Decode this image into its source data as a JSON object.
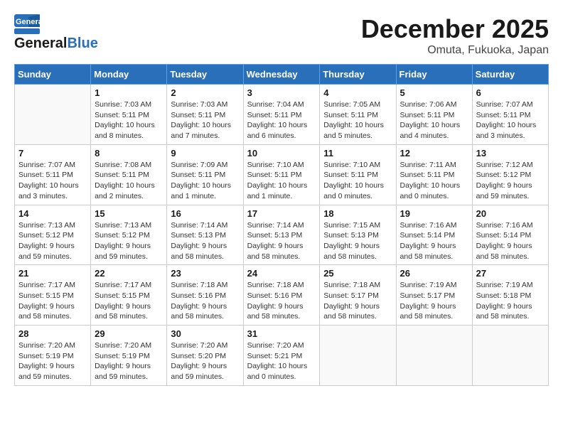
{
  "header": {
    "logo_line1": "General",
    "logo_line2": "Blue",
    "month_title": "December 2025",
    "location": "Omuta, Fukuoka, Japan"
  },
  "weekdays": [
    "Sunday",
    "Monday",
    "Tuesday",
    "Wednesday",
    "Thursday",
    "Friday",
    "Saturday"
  ],
  "weeks": [
    [
      {
        "day": "",
        "info": ""
      },
      {
        "day": "1",
        "info": "Sunrise: 7:03 AM\nSunset: 5:11 PM\nDaylight: 10 hours\nand 8 minutes."
      },
      {
        "day": "2",
        "info": "Sunrise: 7:03 AM\nSunset: 5:11 PM\nDaylight: 10 hours\nand 7 minutes."
      },
      {
        "day": "3",
        "info": "Sunrise: 7:04 AM\nSunset: 5:11 PM\nDaylight: 10 hours\nand 6 minutes."
      },
      {
        "day": "4",
        "info": "Sunrise: 7:05 AM\nSunset: 5:11 PM\nDaylight: 10 hours\nand 5 minutes."
      },
      {
        "day": "5",
        "info": "Sunrise: 7:06 AM\nSunset: 5:11 PM\nDaylight: 10 hours\nand 4 minutes."
      },
      {
        "day": "6",
        "info": "Sunrise: 7:07 AM\nSunset: 5:11 PM\nDaylight: 10 hours\nand 3 minutes."
      }
    ],
    [
      {
        "day": "7",
        "info": "Sunrise: 7:07 AM\nSunset: 5:11 PM\nDaylight: 10 hours\nand 3 minutes."
      },
      {
        "day": "8",
        "info": "Sunrise: 7:08 AM\nSunset: 5:11 PM\nDaylight: 10 hours\nand 2 minutes."
      },
      {
        "day": "9",
        "info": "Sunrise: 7:09 AM\nSunset: 5:11 PM\nDaylight: 10 hours\nand 1 minute."
      },
      {
        "day": "10",
        "info": "Sunrise: 7:10 AM\nSunset: 5:11 PM\nDaylight: 10 hours\nand 1 minute."
      },
      {
        "day": "11",
        "info": "Sunrise: 7:10 AM\nSunset: 5:11 PM\nDaylight: 10 hours\nand 0 minutes."
      },
      {
        "day": "12",
        "info": "Sunrise: 7:11 AM\nSunset: 5:11 PM\nDaylight: 10 hours\nand 0 minutes."
      },
      {
        "day": "13",
        "info": "Sunrise: 7:12 AM\nSunset: 5:12 PM\nDaylight: 9 hours\nand 59 minutes."
      }
    ],
    [
      {
        "day": "14",
        "info": "Sunrise: 7:13 AM\nSunset: 5:12 PM\nDaylight: 9 hours\nand 59 minutes."
      },
      {
        "day": "15",
        "info": "Sunrise: 7:13 AM\nSunset: 5:12 PM\nDaylight: 9 hours\nand 59 minutes."
      },
      {
        "day": "16",
        "info": "Sunrise: 7:14 AM\nSunset: 5:13 PM\nDaylight: 9 hours\nand 58 minutes."
      },
      {
        "day": "17",
        "info": "Sunrise: 7:14 AM\nSunset: 5:13 PM\nDaylight: 9 hours\nand 58 minutes."
      },
      {
        "day": "18",
        "info": "Sunrise: 7:15 AM\nSunset: 5:13 PM\nDaylight: 9 hours\nand 58 minutes."
      },
      {
        "day": "19",
        "info": "Sunrise: 7:16 AM\nSunset: 5:14 PM\nDaylight: 9 hours\nand 58 minutes."
      },
      {
        "day": "20",
        "info": "Sunrise: 7:16 AM\nSunset: 5:14 PM\nDaylight: 9 hours\nand 58 minutes."
      }
    ],
    [
      {
        "day": "21",
        "info": "Sunrise: 7:17 AM\nSunset: 5:15 PM\nDaylight: 9 hours\nand 58 minutes."
      },
      {
        "day": "22",
        "info": "Sunrise: 7:17 AM\nSunset: 5:15 PM\nDaylight: 9 hours\nand 58 minutes."
      },
      {
        "day": "23",
        "info": "Sunrise: 7:18 AM\nSunset: 5:16 PM\nDaylight: 9 hours\nand 58 minutes."
      },
      {
        "day": "24",
        "info": "Sunrise: 7:18 AM\nSunset: 5:16 PM\nDaylight: 9 hours\nand 58 minutes."
      },
      {
        "day": "25",
        "info": "Sunrise: 7:18 AM\nSunset: 5:17 PM\nDaylight: 9 hours\nand 58 minutes."
      },
      {
        "day": "26",
        "info": "Sunrise: 7:19 AM\nSunset: 5:17 PM\nDaylight: 9 hours\nand 58 minutes."
      },
      {
        "day": "27",
        "info": "Sunrise: 7:19 AM\nSunset: 5:18 PM\nDaylight: 9 hours\nand 58 minutes."
      }
    ],
    [
      {
        "day": "28",
        "info": "Sunrise: 7:20 AM\nSunset: 5:19 PM\nDaylight: 9 hours\nand 59 minutes."
      },
      {
        "day": "29",
        "info": "Sunrise: 7:20 AM\nSunset: 5:19 PM\nDaylight: 9 hours\nand 59 minutes."
      },
      {
        "day": "30",
        "info": "Sunrise: 7:20 AM\nSunset: 5:20 PM\nDaylight: 9 hours\nand 59 minutes."
      },
      {
        "day": "31",
        "info": "Sunrise: 7:20 AM\nSunset: 5:21 PM\nDaylight: 10 hours\nand 0 minutes."
      },
      {
        "day": "",
        "info": ""
      },
      {
        "day": "",
        "info": ""
      },
      {
        "day": "",
        "info": ""
      }
    ]
  ]
}
